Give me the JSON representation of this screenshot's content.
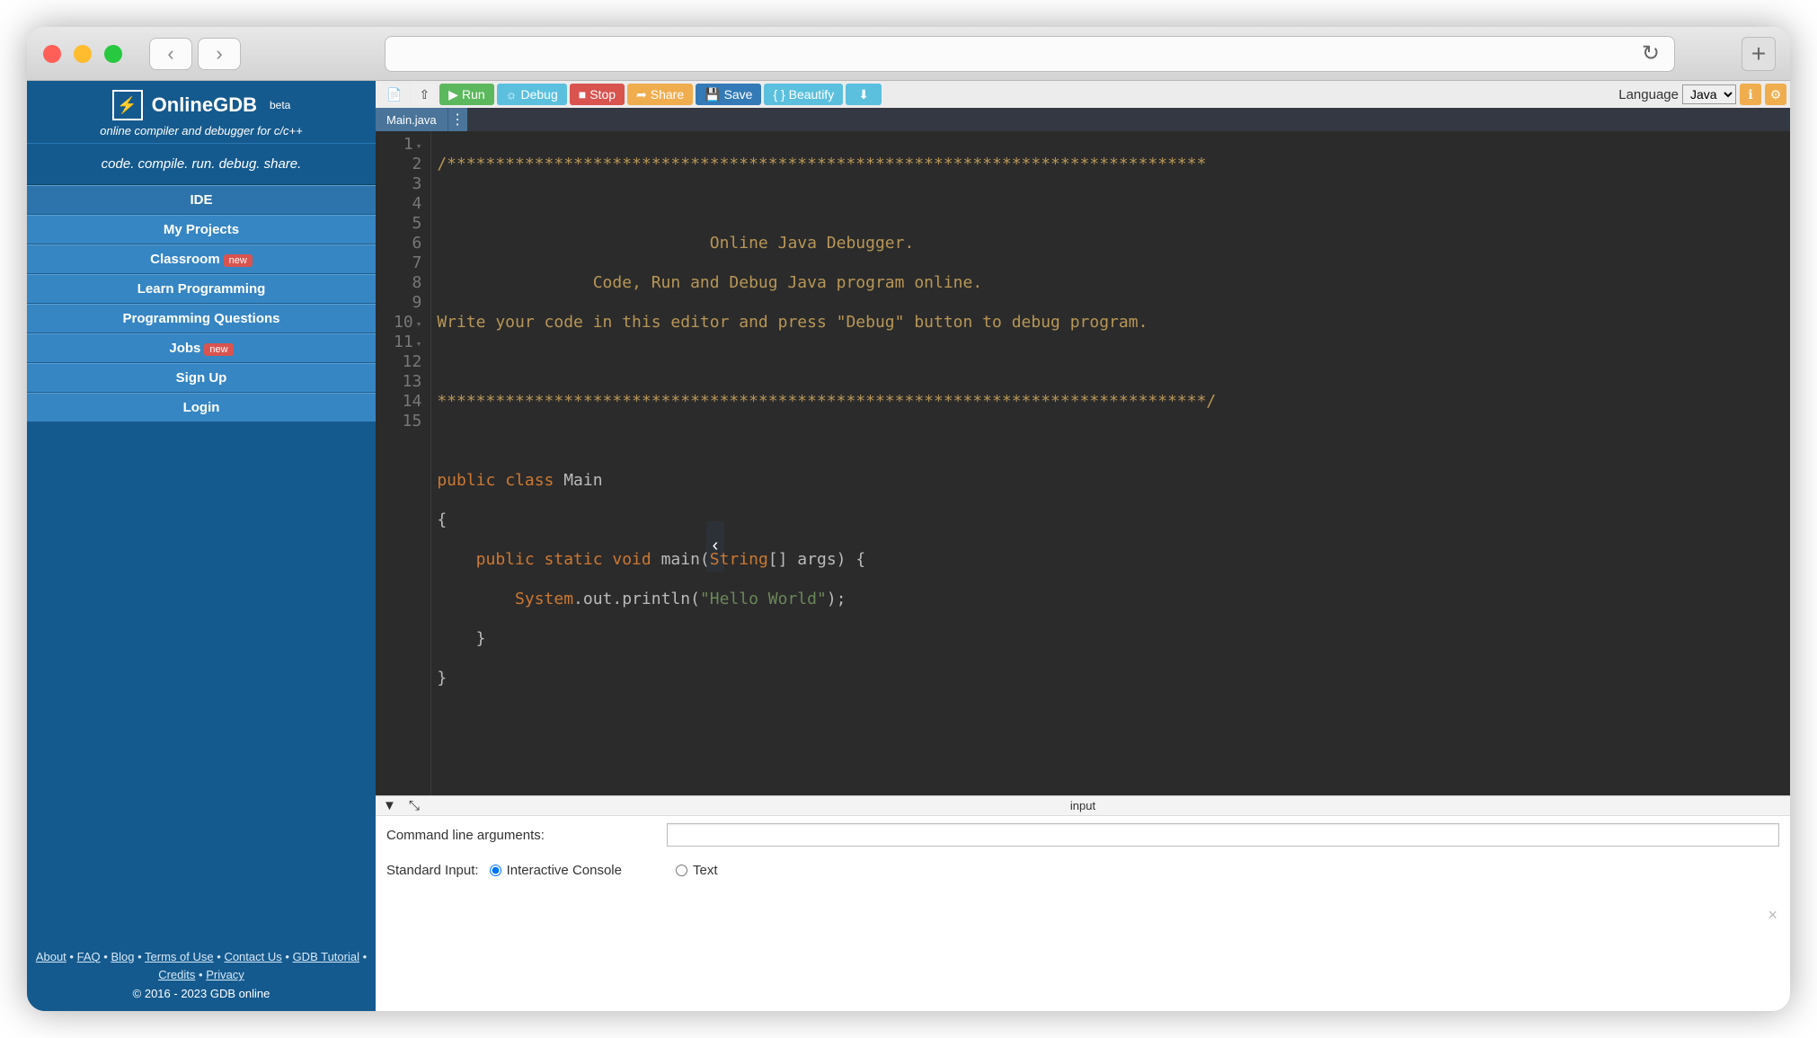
{
  "brand": {
    "name": "OnlineGDB",
    "beta": "beta",
    "subtitle": "online compiler and debugger for c/c++",
    "tagline": "code. compile. run. debug. share."
  },
  "sidebar": {
    "items": [
      {
        "label": "IDE"
      },
      {
        "label": "My Projects"
      },
      {
        "label": "Classroom",
        "badge": "new"
      },
      {
        "label": "Learn Programming"
      },
      {
        "label": "Programming Questions"
      },
      {
        "label": "Jobs",
        "badge": "new"
      },
      {
        "label": "Sign Up"
      },
      {
        "label": "Login"
      }
    ]
  },
  "toolbar": {
    "run": "Run",
    "debug": "Debug",
    "stop": "Stop",
    "share": "Share",
    "save": "Save",
    "beautify": "{ } Beautify",
    "language_label": "Language",
    "language_value": "Java"
  },
  "tab": {
    "filename": "Main.java"
  },
  "editor": {
    "line_numbers": [
      "1",
      "2",
      "3",
      "4",
      "5",
      "6",
      "7",
      "8",
      "9",
      "10",
      "11",
      "12",
      "13",
      "14",
      "15"
    ],
    "code": {
      "l1": "/******************************************************************************",
      "l2": "",
      "l3": "                            Online Java Debugger.",
      "l4": "                Code, Run and Debug Java program online.",
      "l5": "Write your code in this editor and press \"Debug\" button to debug program.",
      "l6": "",
      "l7": "*******************************************************************************/",
      "l8": "",
      "l9_public": "public",
      "l9_class": "class",
      "l9_main": " Main",
      "l10": "{",
      "l11_public": "    public",
      "l11_static": " static",
      "l11_void": " void",
      "l11_main": " main(",
      "l11_string": "String",
      "l11_rest": "[] args) {",
      "l12_pad": "        ",
      "l12_system": "System",
      "l12_out": ".out.println(",
      "l12_str": "\"Hello World\"",
      "l12_end": ");",
      "l13": "    }",
      "l14": "}",
      "l15": ""
    }
  },
  "input_panel": {
    "title": "input",
    "cmd_label": "Command line arguments:",
    "stdin_label": "Standard Input:",
    "opt_interactive": "Interactive Console",
    "opt_text": "Text"
  },
  "footer": {
    "links": [
      "About",
      "FAQ",
      "Blog",
      "Terms of Use",
      "Contact Us",
      "GDB Tutorial",
      "Credits",
      "Privacy"
    ],
    "copyright": "© 2016 - 2023 GDB online"
  }
}
